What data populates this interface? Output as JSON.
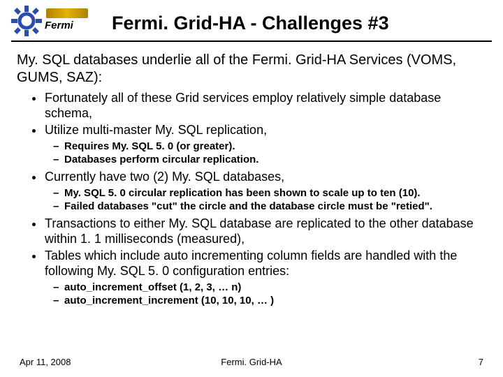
{
  "header": {
    "logo_text": "Fermi",
    "title": "Fermi. Grid-HA - Challenges #3"
  },
  "intro": "My. SQL databases underlie all of the Fermi. Grid-HA Services (VOMS, GUMS, SAZ):",
  "bullets": [
    {
      "text": "Fortunately all of these Grid services employ relatively simple database schema,",
      "sub": []
    },
    {
      "text": "Utilize multi-master My. SQL replication,",
      "sub": [
        "Requires My. SQL 5. 0 (or greater).",
        "Databases perform circular replication."
      ]
    },
    {
      "text": "Currently have two (2) My. SQL databases,",
      "sub": [
        "My. SQL 5. 0 circular replication has been shown to scale up to ten (10).",
        "Failed databases \"cut\" the circle and the database circle must be \"retied\"."
      ]
    },
    {
      "text": "Transactions to either My. SQL database are replicated to the other database within 1. 1 milliseconds (measured),",
      "sub": []
    },
    {
      "text": "Tables which include auto incrementing column fields are handled with the following My. SQL 5. 0 configuration entries:",
      "sub": [
        "auto_increment_offset (1, 2, 3, … n)",
        "auto_increment_increment (10, 10, 10, … )"
      ]
    }
  ],
  "footer": {
    "date": "Apr 11, 2008",
    "center": "Fermi. Grid-HA",
    "page": "7"
  }
}
